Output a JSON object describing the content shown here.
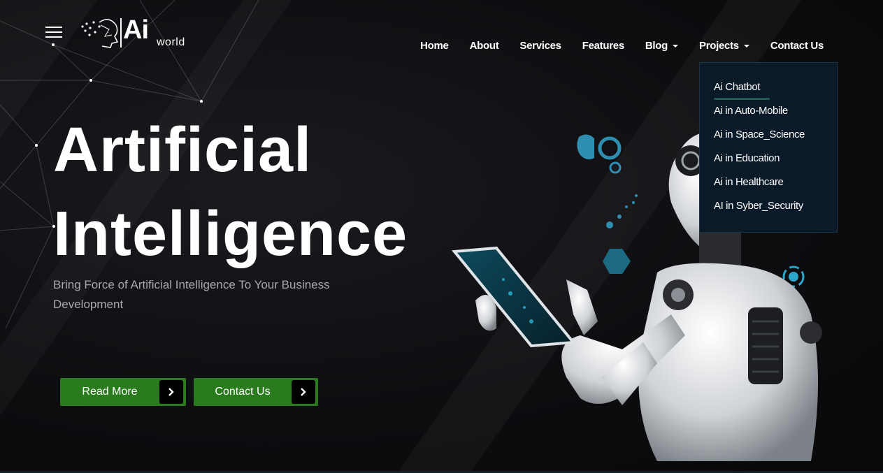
{
  "header": {
    "logo_text": "Ai",
    "logo_subtext": "world",
    "nav": [
      {
        "label": "Home",
        "dropdown": false
      },
      {
        "label": "About",
        "dropdown": false
      },
      {
        "label": "Services",
        "dropdown": false
      },
      {
        "label": "Features",
        "dropdown": false
      },
      {
        "label": "Blog",
        "dropdown": true
      },
      {
        "label": "Projects",
        "dropdown": true
      },
      {
        "label": "Contact Us",
        "dropdown": false
      }
    ]
  },
  "projects_dropdown": {
    "items": [
      {
        "label": "Ai Chatbot",
        "active": true
      },
      {
        "label": "Ai in Auto-Mobile"
      },
      {
        "label": "Ai in Space_Science"
      },
      {
        "label": "Ai in Education"
      },
      {
        "label": "Ai in Healthcare"
      },
      {
        "label": "AI in Syber_Security"
      }
    ]
  },
  "hero": {
    "title_line1": "Artificial",
    "title_line2": "Intelligence",
    "subtitle": "Bring Force of Artificial Intelligence To Your Business Development",
    "buttons": [
      {
        "label": "Read More",
        "icon": "chevron-right-icon"
      },
      {
        "label": "Contact Us",
        "icon": "chevron-right-icon"
      }
    ]
  },
  "colors": {
    "background": "#0c0c0f",
    "button": "#2a7a1e",
    "dropdown_bg": "#0b1a28",
    "accent_cyan": "#2ea6c4"
  }
}
